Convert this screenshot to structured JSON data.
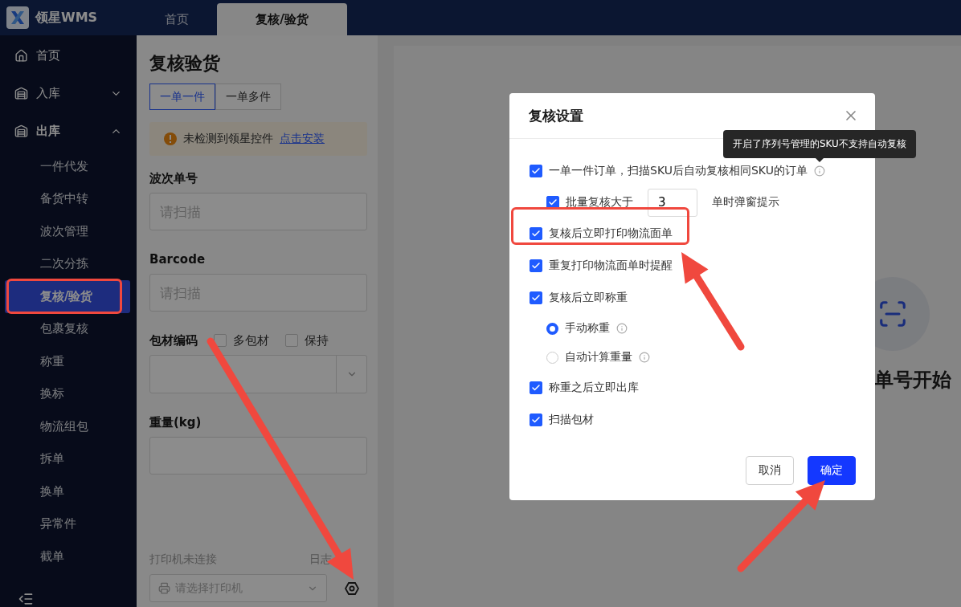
{
  "app": {
    "logo_text": "领星WMS"
  },
  "tabs": [
    {
      "label": "首页",
      "selected": false
    },
    {
      "label": "复核/验货",
      "selected": true
    }
  ],
  "sidebar": {
    "items": [
      {
        "label": "首页",
        "kind": "link"
      },
      {
        "label": "入库",
        "kind": "group",
        "expanded": false
      },
      {
        "label": "出库",
        "kind": "group",
        "expanded": true,
        "children": [
          {
            "label": "一件代发",
            "selected": false,
            "highlighted": false
          },
          {
            "label": "备货中转",
            "selected": false,
            "highlighted": false
          },
          {
            "label": "波次管理",
            "selected": false,
            "highlighted": false
          },
          {
            "label": "二次分拣",
            "selected": false,
            "highlighted": false
          },
          {
            "label": "复核/验货",
            "selected": true,
            "highlighted": true
          },
          {
            "label": "包裹复核",
            "selected": false,
            "highlighted": false
          },
          {
            "label": "称重",
            "selected": false,
            "highlighted": false
          },
          {
            "label": "换标",
            "selected": false,
            "highlighted": false
          },
          {
            "label": "物流组包",
            "selected": false,
            "highlighted": false
          },
          {
            "label": "拆单",
            "selected": false,
            "highlighted": false
          },
          {
            "label": "换单",
            "selected": false,
            "highlighted": false
          },
          {
            "label": "异常件",
            "selected": false,
            "highlighted": false
          },
          {
            "label": "截单",
            "selected": false,
            "highlighted": false
          }
        ]
      }
    ]
  },
  "panel": {
    "title": "复核验货",
    "modes": [
      {
        "label": "一单一件",
        "selected": true
      },
      {
        "label": "一单多件",
        "selected": false
      }
    ],
    "alert": {
      "text": "未检测到领星控件",
      "link": "点击安装"
    },
    "fields": [
      {
        "kind": "input",
        "label": "波次单号",
        "placeholder": "请扫描"
      },
      {
        "kind": "input",
        "label": "Barcode",
        "placeholder": "请扫描"
      },
      {
        "kind": "select",
        "label": "包材编码",
        "options": [
          {
            "label": "多包材",
            "checked": false
          },
          {
            "label": "保持",
            "checked": false
          }
        ]
      },
      {
        "kind": "input",
        "label": "重量(kg)"
      }
    ],
    "printer": {
      "status": "打印机未连接",
      "log": "日志",
      "placeholder": "请选择打印机"
    }
  },
  "main": {
    "prompt": "单号开始"
  },
  "dialog": {
    "title": "复核设置",
    "options": [
      {
        "kind": "checkbox",
        "label": "一单一件订单，扫描SKU后自动复核相同SKU的订单",
        "checked": true,
        "highlighted": false,
        "info": true,
        "tooltip": "开启了序列号管理的SKU不支持自动复核",
        "children": [
          {
            "kind": "threshold",
            "label": "批量复核大于",
            "value": "3",
            "suffix": "单时弹窗提示",
            "checked": true
          }
        ]
      },
      {
        "kind": "checkbox",
        "label": "复核后立即打印物流面单",
        "checked": true,
        "highlighted": true,
        "info": false
      },
      {
        "kind": "checkbox",
        "label": "重复打印物流面单时提醒",
        "checked": true,
        "highlighted": false,
        "info": false
      },
      {
        "kind": "checkbox",
        "label": "复核后立即称重",
        "checked": true,
        "highlighted": false,
        "info": false,
        "children": [
          {
            "kind": "radio",
            "label": "手动称重",
            "selected": true,
            "info": true
          },
          {
            "kind": "radio",
            "label": "自动计算重量",
            "selected": false,
            "info": true
          }
        ]
      },
      {
        "kind": "checkbox",
        "label": "称重之后立即出库",
        "checked": true,
        "highlighted": false,
        "info": false
      },
      {
        "kind": "checkbox",
        "label": "扫描包材",
        "checked": true,
        "highlighted": false,
        "info": false
      }
    ],
    "buttons": [
      {
        "label": "取消",
        "kind": "secondary"
      },
      {
        "label": "确定",
        "kind": "primary"
      }
    ]
  }
}
